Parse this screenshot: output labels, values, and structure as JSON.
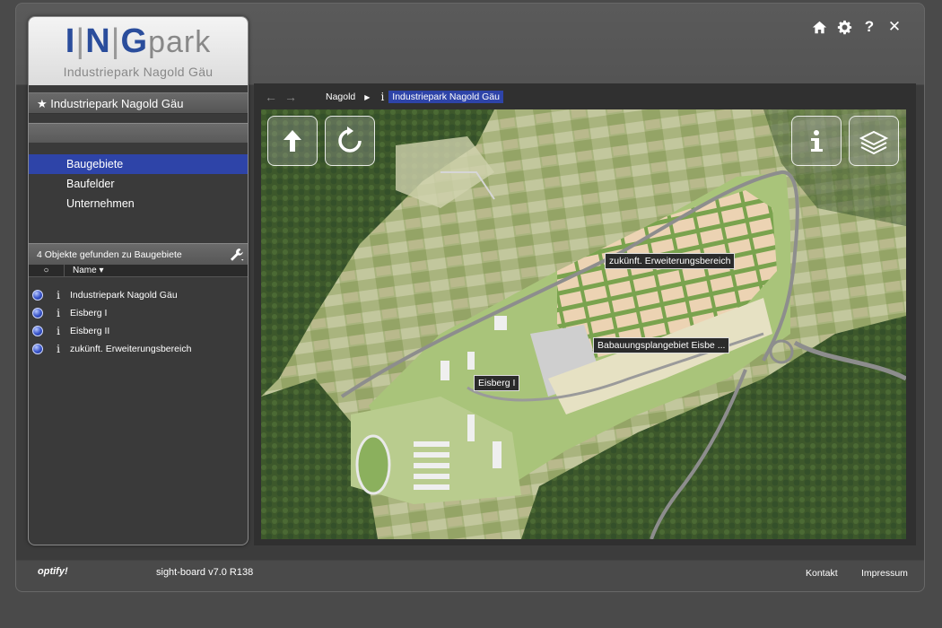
{
  "topbar": {
    "home_icon": "home-icon",
    "settings_icon": "gear-icon",
    "help_label": "?",
    "close_label": "✕"
  },
  "logo": {
    "ing": "ING",
    "park": "park",
    "subtitle": "Industriepark Nagold Gäu"
  },
  "project": {
    "star": "★",
    "name": "Industriepark Nagold Gäu"
  },
  "categories": [
    {
      "label": "Baugebiete",
      "selected": true
    },
    {
      "label": "Baufelder",
      "selected": false
    },
    {
      "label": "Unternehmen",
      "selected": false
    }
  ],
  "results": {
    "summary": "4 Objekte gefunden zu Baugebiete",
    "col_icon": "○",
    "col_name": "Name ▾",
    "items": [
      {
        "info": "i",
        "label": "Industriepark Nagold Gäu"
      },
      {
        "info": "i",
        "label": "Eisberg I"
      },
      {
        "info": "i",
        "label": "Eisberg II"
      },
      {
        "info": "i",
        "label": "zukünft. Erweiterungsbereich"
      }
    ]
  },
  "breadcrumb": {
    "back": "←",
    "forward": "→",
    "crumb1": "Nagold",
    "tri": "▶",
    "info": "i",
    "crumb2": "Industriepark Nagold Gäu"
  },
  "map": {
    "labels": {
      "erweiterung": "zukünft. Erweiterungsbereich",
      "bebauung": "Babauungsplangebiet Eisbe ...",
      "eisberg": "Eisberg I"
    },
    "colors": {
      "forest": "#3f5a2e",
      "field_light": "#b7bf8e",
      "plot": "#e8cfb0",
      "road": "#8c8c8c"
    }
  },
  "footer": {
    "brand": "optify!",
    "version": "sight-board v7.0 R138",
    "kontakt": "Kontakt",
    "impressum": "Impressum"
  },
  "accent": "#2e44a8"
}
